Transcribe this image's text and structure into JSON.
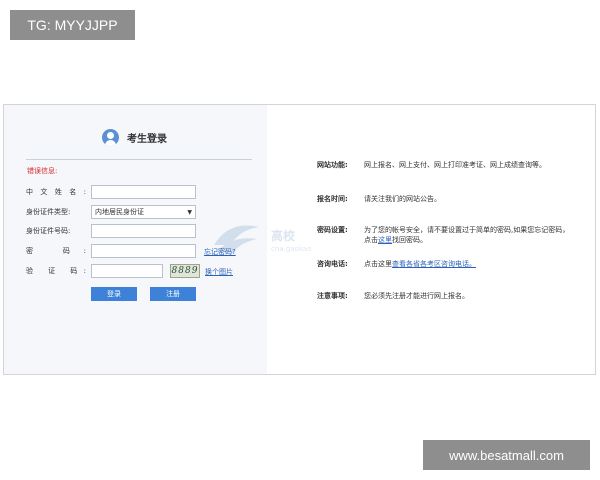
{
  "watermarks": {
    "top": "TG: MYYJJPP",
    "bottom": "www.besatmall.com"
  },
  "login": {
    "title": "考生登录",
    "error_label": "错误信息:",
    "fields": {
      "name_label": "中文姓名:",
      "id_type_label": "身份证件类型:",
      "id_type_value": "内地居民身份证",
      "id_number_label": "身份证件号码:",
      "password_label": "密 码:",
      "captcha_label": "验 证 码:"
    },
    "captcha_image_text": "8889",
    "forgot_password_link": "忘记密码?",
    "change_image_link": "换个图片",
    "login_button": "登录",
    "register_button": "注册"
  },
  "background_logo": {
    "text": "高校",
    "sub": "cna.gaokao"
  },
  "info": {
    "function_label": "网站功能:",
    "function_text": "网上报名、网上支付、网上打印准考证、网上成绩查询等。",
    "time_label": "报名时间:",
    "time_text": "请关注我们的网站公告。",
    "password_label": "密码设置:",
    "password_text_1": "为了您的帐号安全，请不要设置过于简单的密码,如果您忘记密码，点击",
    "password_link": "这里",
    "password_text_2": "找回密码。",
    "phone_label": "咨询电话:",
    "phone_text": "点击这里",
    "phone_link": "查看各省各考区咨询电话。",
    "notice_label": "注意事项:",
    "notice_text": "您必须先注册才能进行网上报名。"
  },
  "colors": {
    "accent": "#3d82d8",
    "link": "#2a62b8",
    "error": "#d9262c",
    "panel_bg": "#f5f7fa"
  }
}
